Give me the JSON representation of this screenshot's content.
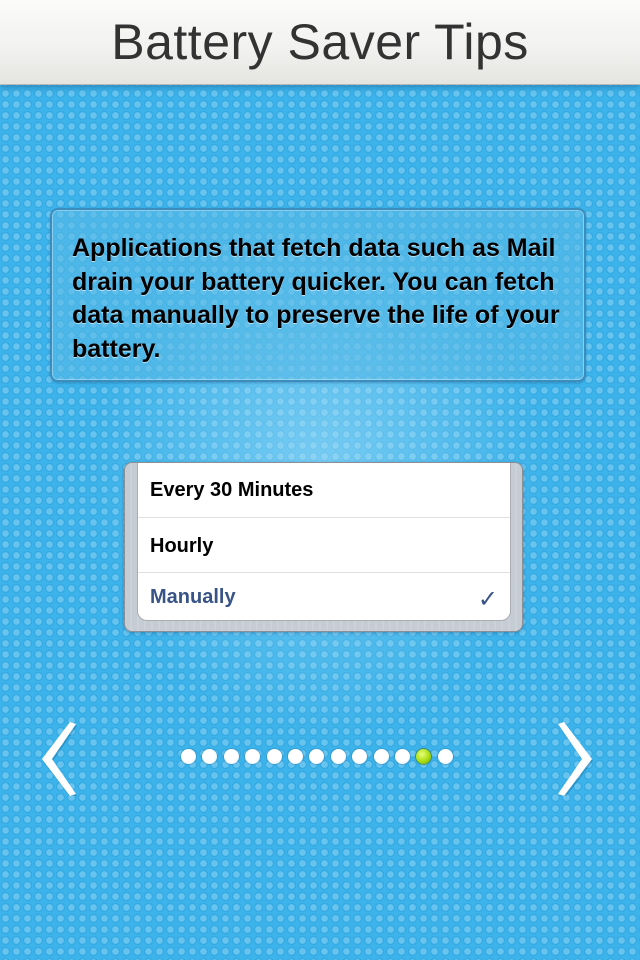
{
  "header": {
    "title": "Battery Saver Tips"
  },
  "tip": {
    "text": "Applications that fetch data such as Mail drain your battery quicker. You can fetch data manually to preserve the life of your battery."
  },
  "fetch_options": {
    "rows": [
      {
        "label": "Every 30 Minutes",
        "selected": false
      },
      {
        "label": "Hourly",
        "selected": false
      },
      {
        "label": "Manually",
        "selected": true
      }
    ],
    "check_glyph": "✓",
    "selected_color": "#385487"
  },
  "navigation": {
    "prev_icon": "chevron-left-icon",
    "next_icon": "chevron-right-icon",
    "page_count": 13,
    "current_page": 12
  },
  "colors": {
    "background": "#3cb3ea",
    "active_dot": "#a9dc10"
  }
}
